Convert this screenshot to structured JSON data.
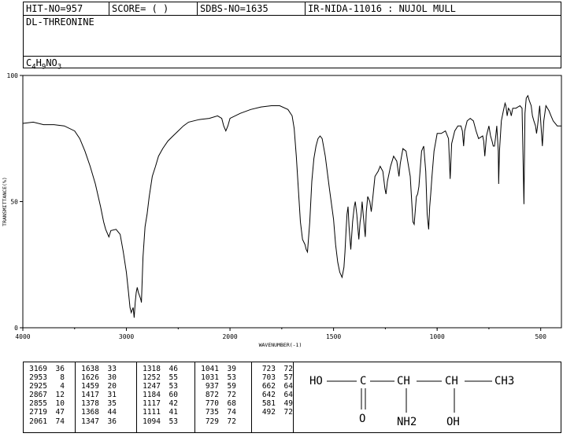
{
  "header": {
    "hit_no": "HIT-NO=957",
    "score": "SCORE=  (   )",
    "sdbs_no": "SDBS-NO=1635",
    "method": "IR-NIDA-11016 : NUJOL MULL"
  },
  "compound_name": "DL-THREONINE",
  "formula": {
    "p1": "C",
    "s1": "4",
    "p2": "H",
    "s2": "9",
    "p3": "NO",
    "s3": "3"
  },
  "chart_data": {
    "type": "line",
    "xlabel": "WAVENUMBER(-1)",
    "ylabel": "TRANSMITTANCE(%)",
    "xlim": [
      4000,
      400
    ],
    "ylim": [
      0,
      100
    ],
    "x_ticks": [
      4000,
      3000,
      2000,
      1500,
      1000,
      500
    ],
    "y_ticks": [
      0,
      50,
      100
    ],
    "spectrum": [
      [
        4000,
        81
      ],
      [
        3900,
        81.5
      ],
      [
        3800,
        80.5
      ],
      [
        3700,
        80.5
      ],
      [
        3600,
        80
      ],
      [
        3500,
        78
      ],
      [
        3450,
        75
      ],
      [
        3400,
        70
      ],
      [
        3350,
        64
      ],
      [
        3300,
        57
      ],
      [
        3250,
        48
      ],
      [
        3220,
        42
      ],
      [
        3200,
        39
      ],
      [
        3169,
        36
      ],
      [
        3150,
        38.5
      ],
      [
        3100,
        39
      ],
      [
        3060,
        37
      ],
      [
        3030,
        30
      ],
      [
        3000,
        22
      ],
      [
        2980,
        14
      ],
      [
        2965,
        8
      ],
      [
        2953,
        6
      ],
      [
        2945,
        7
      ],
      [
        2935,
        8
      ],
      [
        2925,
        4
      ],
      [
        2915,
        10
      ],
      [
        2905,
        14
      ],
      [
        2895,
        16
      ],
      [
        2885,
        14
      ],
      [
        2867,
        12
      ],
      [
        2860,
        11
      ],
      [
        2855,
        10
      ],
      [
        2840,
        28
      ],
      [
        2820,
        40
      ],
      [
        2800,
        45
      ],
      [
        2780,
        52
      ],
      [
        2750,
        60
      ],
      [
        2719,
        64
      ],
      [
        2690,
        68
      ],
      [
        2650,
        71
      ],
      [
        2600,
        74
      ],
      [
        2550,
        76
      ],
      [
        2500,
        78
      ],
      [
        2450,
        80
      ],
      [
        2400,
        81.5
      ],
      [
        2300,
        82.5
      ],
      [
        2200,
        83
      ],
      [
        2120,
        84
      ],
      [
        2080,
        83
      ],
      [
        2061,
        80
      ],
      [
        2040,
        78
      ],
      [
        2020,
        80
      ],
      [
        2000,
        83
      ],
      [
        1950,
        85
      ],
      [
        1900,
        86.5
      ],
      [
        1850,
        87.5
      ],
      [
        1800,
        88
      ],
      [
        1760,
        88
      ],
      [
        1720,
        86.5
      ],
      [
        1700,
        84
      ],
      [
        1690,
        79
      ],
      [
        1680,
        68
      ],
      [
        1670,
        55
      ],
      [
        1660,
        42
      ],
      [
        1650,
        35
      ],
      [
        1638,
        33
      ],
      [
        1632,
        31
      ],
      [
        1626,
        30
      ],
      [
        1615,
        42
      ],
      [
        1605,
        58
      ],
      [
        1595,
        67
      ],
      [
        1585,
        72
      ],
      [
        1575,
        75
      ],
      [
        1565,
        76
      ],
      [
        1555,
        75
      ],
      [
        1540,
        68
      ],
      [
        1520,
        55
      ],
      [
        1500,
        43
      ],
      [
        1490,
        33
      ],
      [
        1480,
        26
      ],
      [
        1470,
        22
      ],
      [
        1459,
        20
      ],
      [
        1450,
        24
      ],
      [
        1445,
        30
      ],
      [
        1440,
        38
      ],
      [
        1435,
        45
      ],
      [
        1430,
        48
      ],
      [
        1425,
        40
      ],
      [
        1417,
        31
      ],
      [
        1408,
        42
      ],
      [
        1400,
        48
      ],
      [
        1395,
        50
      ],
      [
        1388,
        45
      ],
      [
        1378,
        35
      ],
      [
        1372,
        42
      ],
      [
        1368,
        44
      ],
      [
        1362,
        50
      ],
      [
        1356,
        44
      ],
      [
        1347,
        36
      ],
      [
        1342,
        46
      ],
      [
        1335,
        52
      ],
      [
        1325,
        50
      ],
      [
        1318,
        46
      ],
      [
        1310,
        52
      ],
      [
        1300,
        60
      ],
      [
        1285,
        62
      ],
      [
        1275,
        64
      ],
      [
        1262,
        62
      ],
      [
        1252,
        55
      ],
      [
        1247,
        53
      ],
      [
        1240,
        58
      ],
      [
        1225,
        64
      ],
      [
        1210,
        68
      ],
      [
        1195,
        66
      ],
      [
        1184,
        60
      ],
      [
        1178,
        65
      ],
      [
        1165,
        71
      ],
      [
        1150,
        70
      ],
      [
        1140,
        65
      ],
      [
        1130,
        60
      ],
      [
        1117,
        42
      ],
      [
        1111,
        41
      ],
      [
        1100,
        52
      ],
      [
        1094,
        53
      ],
      [
        1088,
        56
      ],
      [
        1075,
        70
      ],
      [
        1065,
        72
      ],
      [
        1055,
        62
      ],
      [
        1048,
        45
      ],
      [
        1041,
        39
      ],
      [
        1036,
        48
      ],
      [
        1031,
        53
      ],
      [
        1025,
        60
      ],
      [
        1015,
        70
      ],
      [
        1000,
        77
      ],
      [
        980,
        77
      ],
      [
        960,
        78
      ],
      [
        945,
        75
      ],
      [
        937,
        59
      ],
      [
        930,
        73
      ],
      [
        915,
        78
      ],
      [
        900,
        80
      ],
      [
        885,
        80
      ],
      [
        878,
        78
      ],
      [
        872,
        72
      ],
      [
        867,
        78
      ],
      [
        855,
        82
      ],
      [
        840,
        83
      ],
      [
        825,
        82
      ],
      [
        812,
        78
      ],
      [
        800,
        75
      ],
      [
        780,
        76
      ],
      [
        775,
        74
      ],
      [
        770,
        68
      ],
      [
        762,
        76
      ],
      [
        750,
        80
      ],
      [
        742,
        76
      ],
      [
        735,
        74
      ],
      [
        729,
        72
      ],
      [
        723,
        72
      ],
      [
        717,
        76
      ],
      [
        712,
        80
      ],
      [
        705,
        70
      ],
      [
        703,
        57
      ],
      [
        699,
        70
      ],
      [
        690,
        82
      ],
      [
        680,
        86
      ],
      [
        672,
        89
      ],
      [
        668,
        88
      ],
      [
        662,
        84
      ],
      [
        656,
        87
      ],
      [
        648,
        86
      ],
      [
        642,
        84
      ],
      [
        635,
        87
      ],
      [
        620,
        87
      ],
      [
        600,
        88
      ],
      [
        590,
        87
      ],
      [
        581,
        49
      ],
      [
        576,
        85
      ],
      [
        570,
        91
      ],
      [
        562,
        92
      ],
      [
        555,
        90
      ],
      [
        546,
        88
      ],
      [
        540,
        84
      ],
      [
        533,
        82
      ],
      [
        525,
        80
      ],
      [
        520,
        77
      ],
      [
        515,
        80
      ],
      [
        505,
        88
      ],
      [
        497,
        78
      ],
      [
        492,
        72
      ],
      [
        485,
        82
      ],
      [
        475,
        88
      ],
      [
        460,
        86
      ],
      [
        450,
        84
      ],
      [
        440,
        82
      ],
      [
        420,
        80
      ],
      [
        400,
        80
      ]
    ]
  },
  "peaks": [
    [
      [
        "3169",
        "36"
      ],
      [
        "2953",
        "8"
      ],
      [
        "2925",
        "4"
      ],
      [
        "2867",
        "12"
      ],
      [
        "2855",
        "10"
      ],
      [
        "2719",
        "47"
      ],
      [
        "2061",
        "74"
      ]
    ],
    [
      [
        "1638",
        "33"
      ],
      [
        "1626",
        "30"
      ],
      [
        "1459",
        "20"
      ],
      [
        "1417",
        "31"
      ],
      [
        "1378",
        "35"
      ],
      [
        "1368",
        "44"
      ],
      [
        "1347",
        "36"
      ]
    ],
    [
      [
        "1318",
        "46"
      ],
      [
        "1252",
        "55"
      ],
      [
        "1247",
        "53"
      ],
      [
        "1184",
        "60"
      ],
      [
        "1117",
        "42"
      ],
      [
        "1111",
        "41"
      ],
      [
        "1094",
        "53"
      ]
    ],
    [
      [
        "1041",
        "39"
      ],
      [
        "1031",
        "53"
      ],
      [
        "937",
        "59"
      ],
      [
        "872",
        "72"
      ],
      [
        "770",
        "68"
      ],
      [
        "735",
        "74"
      ],
      [
        "729",
        "72"
      ]
    ],
    [
      [
        "723",
        "72"
      ],
      [
        "703",
        "57"
      ],
      [
        "662",
        "64"
      ],
      [
        "642",
        "64"
      ],
      [
        "581",
        "49"
      ],
      [
        "492",
        "72"
      ]
    ]
  ],
  "structure": {
    "ho": "HO",
    "c1": "C",
    "ch1": "CH",
    "ch2": "CH",
    "ch3": "CH3",
    "o": "O",
    "nh2": "NH2",
    "oh": "OH"
  }
}
